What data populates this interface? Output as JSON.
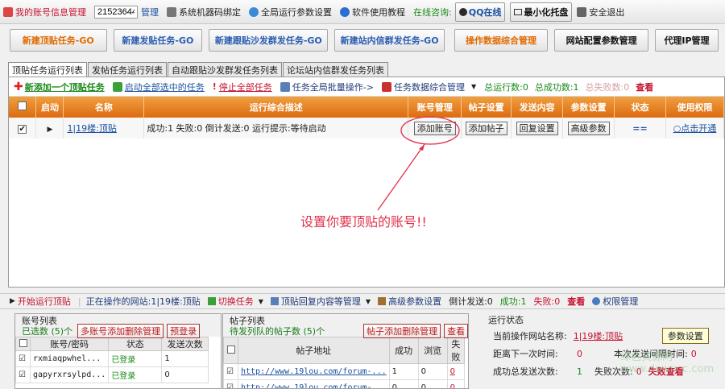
{
  "topbar": {
    "account_manage": "我的账号信息管理",
    "account_id": "21523644",
    "manage": "管理",
    "bind": "系统机器码绑定",
    "global_params": "全局运行参数设置",
    "tutorial": "软件使用教程",
    "consult": "在线咨询:",
    "qq": "QQ在线",
    "minimize": "最小化托盘",
    "exit": "安全退出"
  },
  "tasks": {
    "new_top": "新建顶贴任务-GO",
    "new_post": "新建发贴任务-GO",
    "new_follow": "新建跟贴沙发群发任务-GO",
    "new_pm": "新建站内信群发任务-GO",
    "data_manage": "操作数据综合管理",
    "site_config": "网站配置参数管理",
    "proxy": "代理IP管理"
  },
  "tabs": [
    "顶贴任务运行列表",
    "发帖任务运行列表",
    "自动跟贴沙发群发任务列表",
    "论坛站内信群发任务列表"
  ],
  "toolbar": {
    "add_new": "新添加一个顶贴任务",
    "start_all": "启动全部选中的任务",
    "stop_all": "停止全部任务",
    "batch": "任务全局批量操作->",
    "data_mgmt": "任务数据综合管理",
    "running": "总运行数:0",
    "success": "总成功数:1",
    "fail": "总失败数:0",
    "view": "查看"
  },
  "grid": {
    "headers": [
      "",
      "启动",
      "名称",
      "运行综合描述",
      "账号管理",
      "帖子设置",
      "发送内容",
      "参数设置",
      "状态",
      "使用权限"
    ],
    "row": {
      "name": "1|19楼:顶贴",
      "desc": "成功:1 失败:0 倒计发送:0 运行提示:等待启动",
      "add_account": "添加账号",
      "add_post": "添加帖子",
      "reply_setting": "回复设置",
      "advanced": "高级参数",
      "status": "==",
      "permission": "○点击开通"
    }
  },
  "annotation": "设置你要顶贴的账号!!",
  "bottombar": {
    "start": "开始运行顶贴",
    "current": "正在操作的网站:1|19楼:顶贴",
    "switch": "切换任务",
    "reply_mgmt": "顶贴回复内容等管理",
    "advanced": "高级参数设置",
    "countdown": "倒计发送:0",
    "success": "成功:1",
    "fail": "失败:0",
    "view": "查看",
    "permission": "权限管理"
  },
  "accounts": {
    "title": "账号列表",
    "selected": "已选数 (5)个",
    "multi_btn": "多账号添加删除管理",
    "reserve_btn": "预登录",
    "headers": [
      "",
      "账号/密码",
      "状态",
      "发送次数"
    ],
    "rows": [
      {
        "account": "rxmiaqpwhel...",
        "status": "已登录",
        "count": "1"
      },
      {
        "account": "gapyrxrsylpd...",
        "status": "已登录",
        "count": "0"
      }
    ]
  },
  "posts": {
    "title": "帖子列表",
    "pending": "待发列队的帖子数 (5)个",
    "manage_btn": "帖子添加删除管理",
    "view_btn": "查看",
    "headers": [
      "",
      "帖子地址",
      "成功",
      "浏览",
      "失败"
    ],
    "rows": [
      {
        "url": "http://www.19lou.com/forum-...",
        "success": "1",
        "views": "0",
        "fail": "0"
      },
      {
        "url": "http://www.19lou.com/forum-...",
        "success": "0",
        "views": "0",
        "fail": "0"
      }
    ]
  },
  "status": {
    "title": "运行状态",
    "site_label": "当前操作网站名称:",
    "site_value": "1|19楼:顶贴",
    "param_btn": "参数设置",
    "next_label": "距离下一次时间:",
    "next_value": "0",
    "interval_label": "本次发送间隔时间:",
    "interval_value": "0",
    "total_label": "成功总发送次数:",
    "total_value": "1",
    "fail_label": "失败次数:",
    "fail_value": "0",
    "fail_view": "失败查看"
  },
  "watermark": "绿色资源网\nwww.downcc.com"
}
